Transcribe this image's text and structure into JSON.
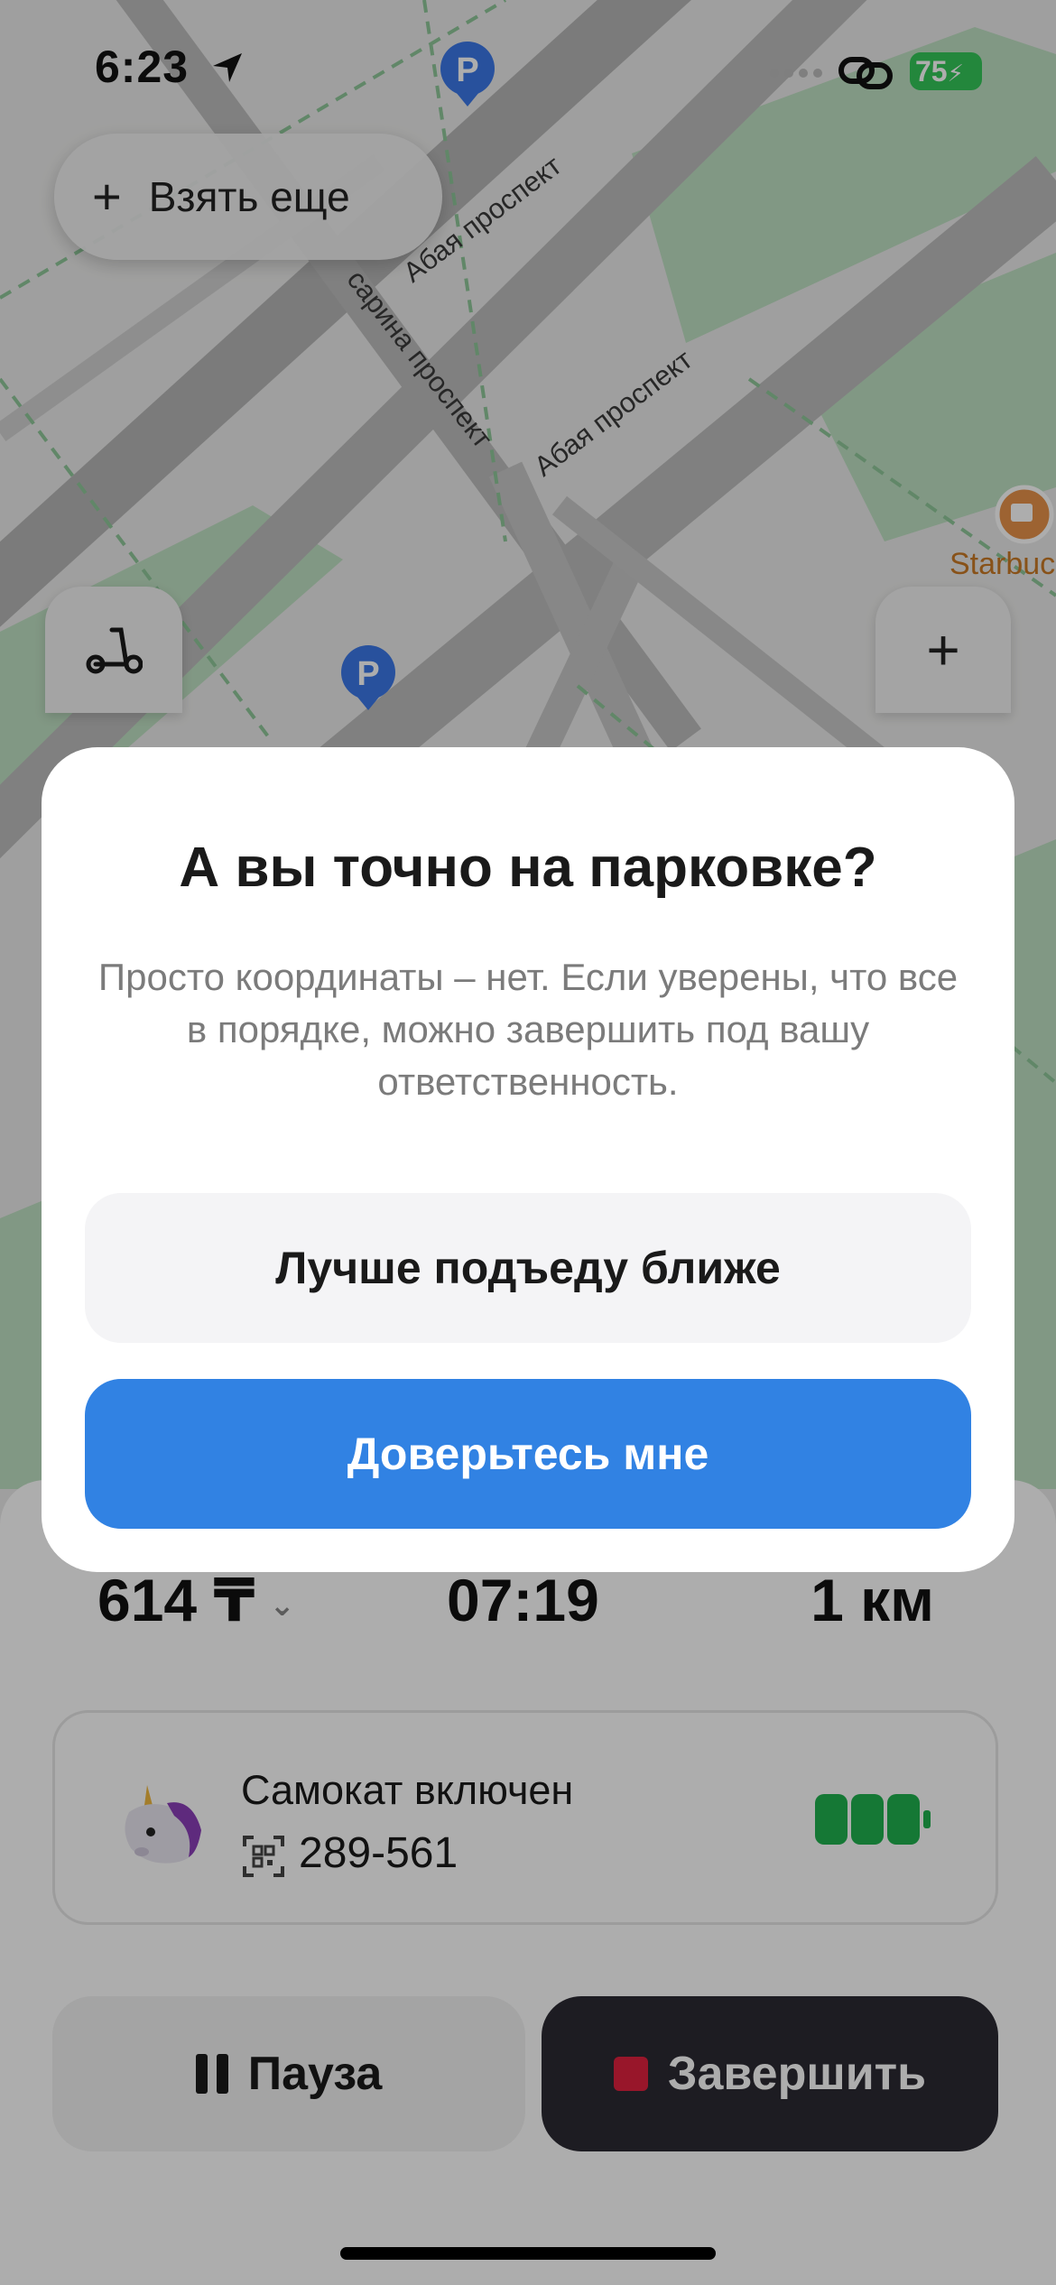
{
  "status_bar": {
    "time": "6:23",
    "battery": "75"
  },
  "map": {
    "take_more_label": "Взять еще",
    "streets": [
      "Абая проспект",
      "Абая проспект",
      "сарина проспект"
    ],
    "poi_label": "Starbuc",
    "parking_label": "P"
  },
  "trip": {
    "cost": "614 ₸",
    "duration": "07:19",
    "distance": "1 км"
  },
  "scooter": {
    "state": "Самокат включен",
    "code": "289-561"
  },
  "actions": {
    "pause_label": "Пауза",
    "finish_label": "Завершить"
  },
  "dialog": {
    "title": "А вы точно на парковке?",
    "body": "Просто координаты – нет. Если уверены, что все в порядке, можно завершить под вашу ответственность.",
    "secondary_label": "Лучше подъеду ближе",
    "primary_label": "Доверьтесь мне"
  },
  "colors": {
    "primary": "#3182e3",
    "finish_bg": "#2b2a33",
    "finish_icon": "#e0213f",
    "battery_green": "#34c759",
    "scooter_battery": "#1fb14f",
    "parking_pin": "#3b78e7"
  },
  "icons": [
    "location-arrow-icon",
    "link-icon",
    "plus-icon",
    "scooter-icon",
    "parking-pin-icon",
    "coffee-icon",
    "unicorn-avatar-icon",
    "qr-code-icon",
    "battery-icon",
    "pause-icon",
    "stop-icon"
  ]
}
